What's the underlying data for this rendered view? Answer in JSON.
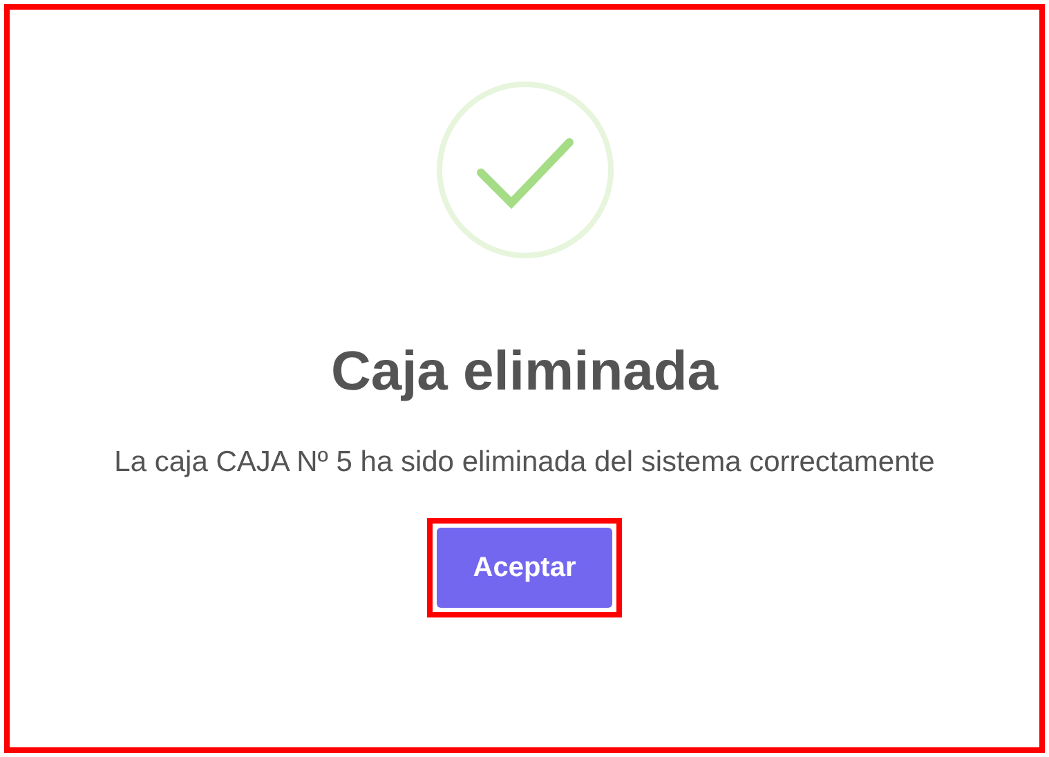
{
  "dialog": {
    "kind": "success",
    "title": "Caja eliminada",
    "message": "La caja CAJA Nº 5 ha sido eliminada del sistema correctamente",
    "confirm_button": {
      "label": "Aceptar",
      "highlighted": true
    }
  }
}
